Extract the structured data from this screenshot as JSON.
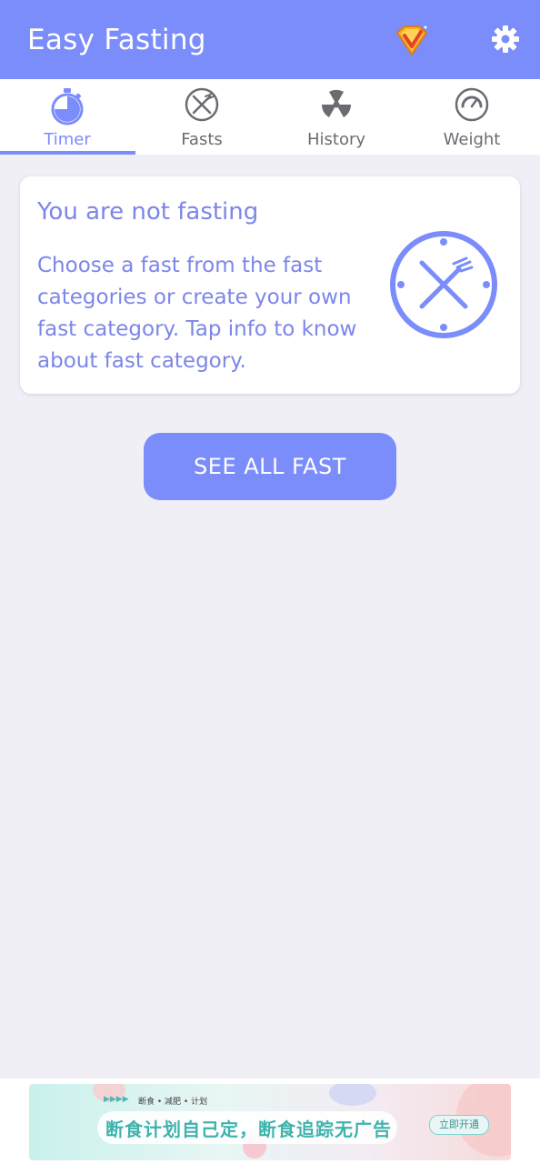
{
  "app": {
    "title": "Easy Fasting"
  },
  "tabs": [
    {
      "label": "Timer",
      "icon": "stopwatch-icon",
      "active": true
    },
    {
      "label": "Fasts",
      "icon": "fork-knife-icon",
      "active": false
    },
    {
      "label": "History",
      "icon": "radiation-icon",
      "active": false
    },
    {
      "label": "Weight",
      "icon": "scale-gauge-icon",
      "active": false
    }
  ],
  "status_card": {
    "title": "You are not fasting",
    "body": "Choose a fast from the fast categories or create your own fast category. Tap info to know about fast category.",
    "icon": "clock-cutlery-icon"
  },
  "cta": {
    "label": "SEE ALL FAST"
  },
  "ad": {
    "arrows": "▶▶▶▶",
    "tagline": "断食 • 减肥 • 计划",
    "headline": "断食计划自己定，断食追踪无广告",
    "button": "立即开通"
  },
  "colors": {
    "accent": "#7b8cfb",
    "text_accent": "#7c86e8",
    "background": "#f1eff6",
    "inactive_tab": "#6b6b73"
  }
}
